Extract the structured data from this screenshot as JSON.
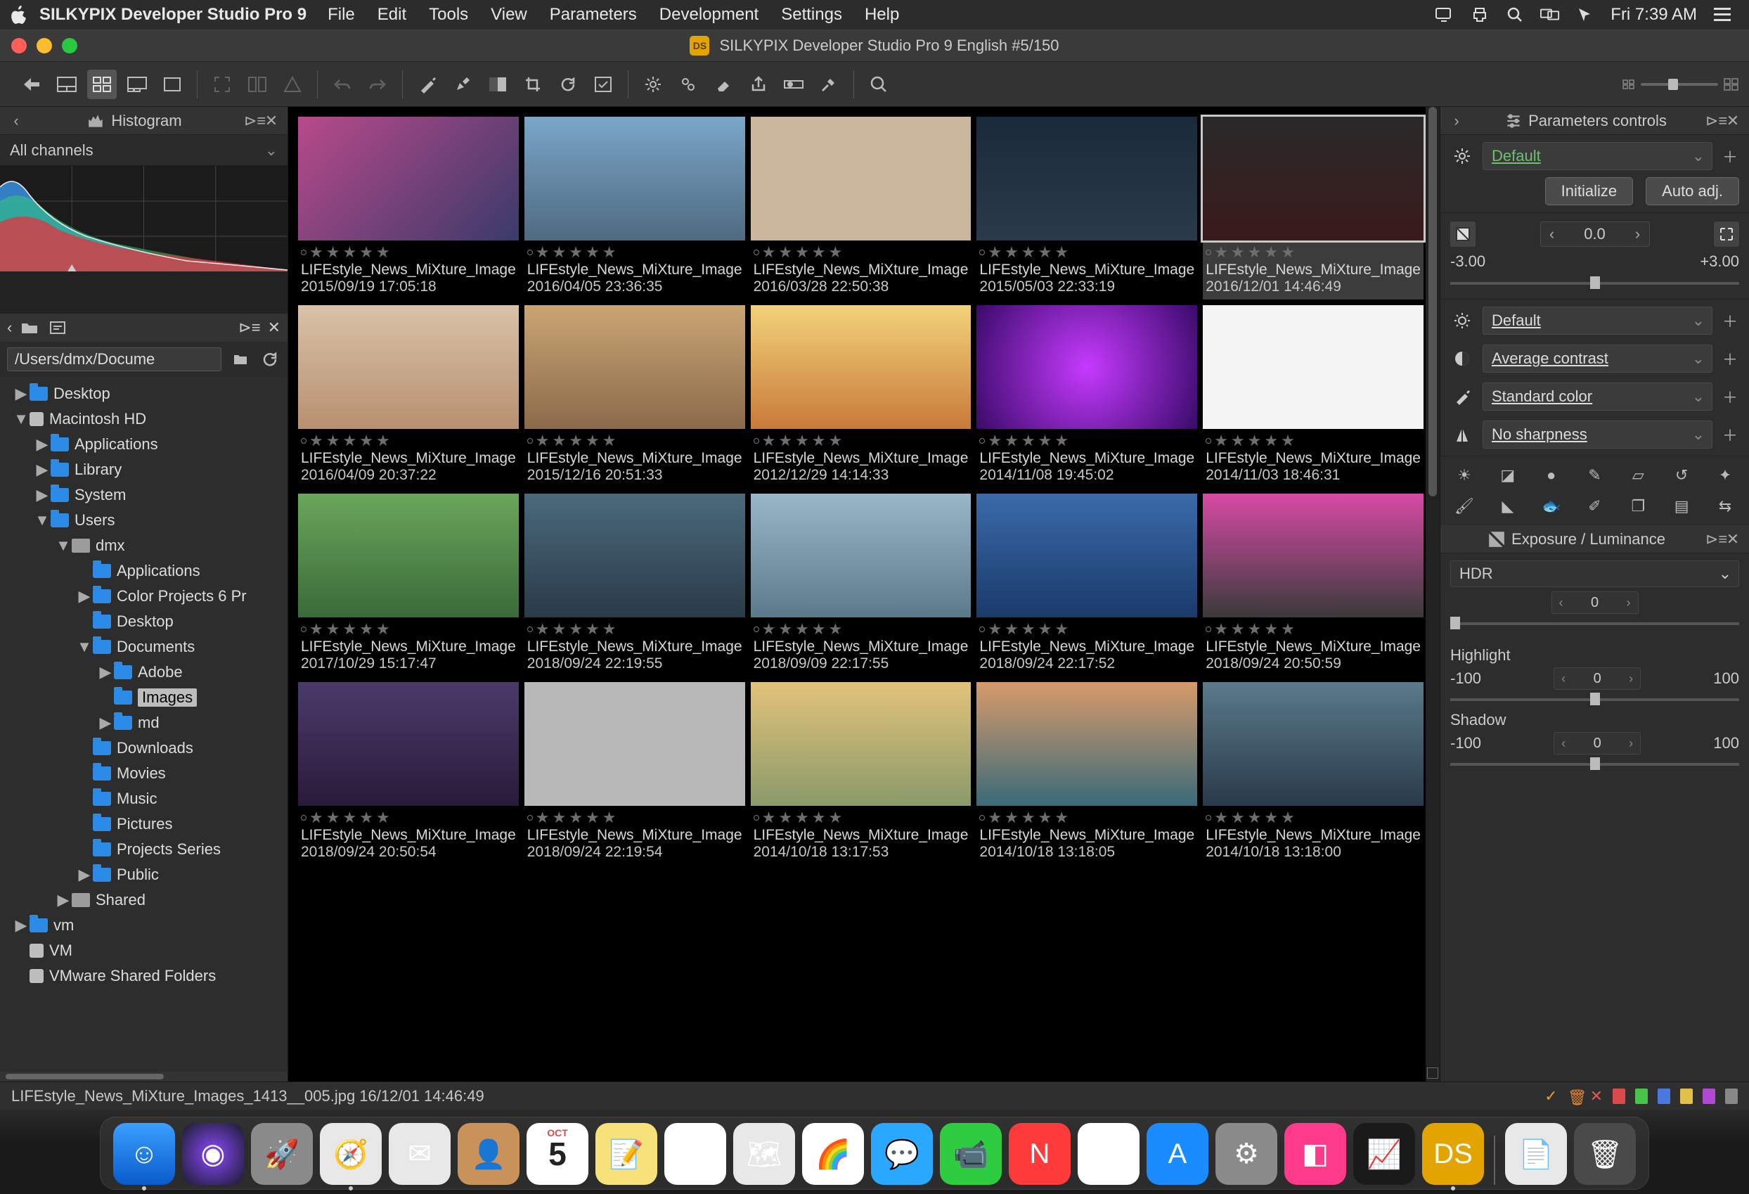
{
  "menubar": {
    "app": "SILKYPIX Developer Studio Pro 9",
    "menus": [
      "File",
      "Edit",
      "Tools",
      "View",
      "Parameters",
      "Development",
      "Settings",
      "Help"
    ],
    "clock": "Fri 7:39 AM"
  },
  "window": {
    "title": "SILKYPIX Developer Studio Pro 9 English   #5/150"
  },
  "histogram": {
    "title": "Histogram",
    "channel": "All channels"
  },
  "path_input": "/Users/dmx/Docume",
  "tree": [
    {
      "d": 0,
      "tw": "▶",
      "kind": "blue",
      "label": "Desktop"
    },
    {
      "d": 0,
      "tw": "▼",
      "kind": "disk",
      "label": "Macintosh HD"
    },
    {
      "d": 1,
      "tw": "▶",
      "kind": "blue",
      "label": "Applications"
    },
    {
      "d": 1,
      "tw": "▶",
      "kind": "blue",
      "label": "Library"
    },
    {
      "d": 1,
      "tw": "▶",
      "kind": "blue",
      "label": "System"
    },
    {
      "d": 1,
      "tw": "▼",
      "kind": "blue",
      "label": "Users"
    },
    {
      "d": 2,
      "tw": "▼",
      "kind": "grey",
      "label": "dmx"
    },
    {
      "d": 3,
      "tw": "",
      "kind": "blue",
      "label": "Applications"
    },
    {
      "d": 3,
      "tw": "▶",
      "kind": "blue",
      "label": "Color Projects 6 Pr"
    },
    {
      "d": 3,
      "tw": "",
      "kind": "blue",
      "label": "Desktop"
    },
    {
      "d": 3,
      "tw": "▼",
      "kind": "blue",
      "label": "Documents"
    },
    {
      "d": 4,
      "tw": "▶",
      "kind": "blue",
      "label": "Adobe"
    },
    {
      "d": 4,
      "tw": "",
      "kind": "blue",
      "label": "Images",
      "selected": true
    },
    {
      "d": 4,
      "tw": "▶",
      "kind": "blue",
      "label": "md"
    },
    {
      "d": 3,
      "tw": "",
      "kind": "blue",
      "label": "Downloads"
    },
    {
      "d": 3,
      "tw": "",
      "kind": "blue",
      "label": "Movies"
    },
    {
      "d": 3,
      "tw": "",
      "kind": "blue",
      "label": "Music"
    },
    {
      "d": 3,
      "tw": "",
      "kind": "blue",
      "label": "Pictures"
    },
    {
      "d": 3,
      "tw": "",
      "kind": "blue",
      "label": "Projects Series"
    },
    {
      "d": 3,
      "tw": "▶",
      "kind": "blue",
      "label": "Public"
    },
    {
      "d": 2,
      "tw": "▶",
      "kind": "grey",
      "label": "Shared"
    },
    {
      "d": 0,
      "tw": "▶",
      "kind": "blue",
      "label": "vm"
    },
    {
      "d": 0,
      "tw": "",
      "kind": "disk",
      "label": "VM"
    },
    {
      "d": 0,
      "tw": "",
      "kind": "disk",
      "label": "VMware Shared Folders"
    }
  ],
  "thumbs": [
    {
      "name_prefix": "LIFEstyle_News_MiXture_Image",
      "date": "2015/09/19 17:05:18",
      "bg": "linear-gradient(135deg,#b84a8a,#3a3a6a)"
    },
    {
      "name_prefix": "LIFEstyle_News_MiXture_Image",
      "date": "2016/04/05 23:36:35",
      "bg": "linear-gradient(#7aa6c9,#4f6a80)"
    },
    {
      "name_prefix": "LIFEstyle_News_MiXture_Image",
      "date": "2016/03/28 22:50:38",
      "bg": "#cbb79d"
    },
    {
      "name_prefix": "LIFEstyle_News_MiXture_Image",
      "date": "2015/05/03 22:33:19",
      "bg": "linear-gradient(#1a2a3a,#2a3a4a)"
    },
    {
      "name_prefix": "LIFEstyle_News_MiXture_Image",
      "date": "2016/12/01 14:46:49",
      "bg": "linear-gradient(#2a2a2a,#3a1a1a)",
      "selected": true
    },
    {
      "name_prefix": "LIFEstyle_News_MiXture_Image",
      "date": "2016/04/09 20:37:22",
      "bg": "linear-gradient(#d8c2a8,#b89070)"
    },
    {
      "name_prefix": "LIFEstyle_News_MiXture_Image",
      "date": "2015/12/16 20:51:33",
      "bg": "linear-gradient(#caa574,#8a6a4a)"
    },
    {
      "name_prefix": "LIFEstyle_News_MiXture_Image",
      "date": "2012/12/29 14:14:33",
      "bg": "linear-gradient(#f2d27a,#c97a3a)"
    },
    {
      "name_prefix": "LIFEstyle_News_MiXture_Image",
      "date": "2014/11/08 19:45:02",
      "bg": "radial-gradient(circle,#c63aff,#3a0a6a)"
    },
    {
      "name_prefix": "LIFEstyle_News_MiXture_Image",
      "date": "2014/11/03 18:46:31",
      "bg": "#f4f4f4"
    },
    {
      "name_prefix": "LIFEstyle_News_MiXture_Image",
      "date": "2017/10/29 15:17:47",
      "bg": "linear-gradient(#6aa65a,#3a6a3a)"
    },
    {
      "name_prefix": "LIFEstyle_News_MiXture_Image",
      "date": "2018/09/24 22:19:55",
      "bg": "linear-gradient(#4a6a7a,#2a3a4a)"
    },
    {
      "name_prefix": "LIFEstyle_News_MiXture_Image",
      "date": "2018/09/09 22:17:55",
      "bg": "linear-gradient(#9ab6c9,#5a7a8a)"
    },
    {
      "name_prefix": "LIFEstyle_News_MiXture_Image",
      "date": "2018/09/24 22:17:52",
      "bg": "linear-gradient(#3a6aaa,#1a3a6a)"
    },
    {
      "name_prefix": "LIFEstyle_News_MiXture_Image",
      "date": "2018/09/24 20:50:59",
      "bg": "linear-gradient(#d84aa6,#3a3a3a)"
    },
    {
      "name_prefix": "LIFEstyle_News_MiXture_Image",
      "date": "2018/09/24 20:50:54",
      "bg": "linear-gradient(#4a3a6a,#2a1a3a)"
    },
    {
      "name_prefix": "LIFEstyle_News_MiXture_Image",
      "date": "2018/09/24 22:19:54",
      "bg": "#b8b8b8"
    },
    {
      "name_prefix": "LIFEstyle_News_MiXture_Image",
      "date": "2014/10/18 13:17:53",
      "bg": "linear-gradient(#e2c37a,#8a9a6a)"
    },
    {
      "name_prefix": "LIFEstyle_News_MiXture_Image",
      "date": "2014/10/18 13:18:05",
      "bg": "linear-gradient(#d89a6a,#3a6a7a)"
    },
    {
      "name_prefix": "LIFEstyle_News_MiXture_Image",
      "date": "2014/10/18 13:18:00",
      "bg": "linear-gradient(#5a7a8a,#2a3a4a)"
    }
  ],
  "infobar": {
    "text": "LIFEstyle_News_MiXture_Images_1413__005.jpg 16/12/01 14:46:49"
  },
  "params": {
    "title": "Parameters controls",
    "preset": "Default",
    "init": "Initialize",
    "auto": "Auto adj.",
    "ev_value": "0.0",
    "ev_min": "-3.00",
    "ev_max": "+3.00",
    "wb": "Default",
    "contrast": "Average contrast",
    "color": "Standard color",
    "sharp": "No sharpness"
  },
  "exposure_panel": {
    "title": "Exposure / Luminance",
    "hdr_label": "HDR",
    "hdr_value": "0",
    "highlight_label": "Highlight",
    "hl_min": "-100",
    "hl_val": "0",
    "hl_max": "100",
    "shadow_label": "Shadow",
    "sh_min": "-100",
    "sh_val": "0",
    "sh_max": "100"
  },
  "dock": [
    {
      "name": "finder",
      "bg": "linear-gradient(#3aa0ff,#0a5acc)",
      "glyph": "☺"
    },
    {
      "name": "siri",
      "bg": "radial-gradient(circle,#8a4aff,#1a1a2a)",
      "glyph": "◉"
    },
    {
      "name": "launchpad",
      "bg": "#8a8a8a",
      "glyph": "🚀"
    },
    {
      "name": "safari",
      "bg": "#e8e8e8",
      "glyph": "🧭"
    },
    {
      "name": "mail",
      "bg": "#e8e8e8",
      "glyph": "✉"
    },
    {
      "name": "contacts",
      "bg": "#c8925a",
      "glyph": "👤"
    },
    {
      "name": "calendar",
      "bg": "#fff",
      "glyph": "5"
    },
    {
      "name": "notes",
      "bg": "#f7e27a",
      "glyph": "📝"
    },
    {
      "name": "reminders",
      "bg": "#fff",
      "glyph": "☑"
    },
    {
      "name": "maps",
      "bg": "#e8e8e8",
      "glyph": "🗺"
    },
    {
      "name": "photos",
      "bg": "#fff",
      "glyph": "🌈"
    },
    {
      "name": "messages",
      "bg": "#2aa8ff",
      "glyph": "💬"
    },
    {
      "name": "facetime",
      "bg": "#2ecc40",
      "glyph": "📹"
    },
    {
      "name": "news",
      "bg": "#ff3a3a",
      "glyph": "N"
    },
    {
      "name": "itunes",
      "bg": "#fff",
      "glyph": "♪"
    },
    {
      "name": "appstore",
      "bg": "#1a8cff",
      "glyph": "A"
    },
    {
      "name": "sysprefs",
      "bg": "#8a8a8a",
      "glyph": "⚙"
    },
    {
      "name": "cleanmymac",
      "bg": "#ff3a8a",
      "glyph": "◧"
    },
    {
      "name": "activity",
      "bg": "#1a1a1a",
      "glyph": "📈"
    },
    {
      "name": "silkypix",
      "bg": "#e4a400",
      "glyph": "DS"
    },
    {
      "name": "sep"
    },
    {
      "name": "docs",
      "bg": "#e8e8e8",
      "glyph": "📄"
    },
    {
      "name": "trash",
      "bg": "#4a4a4a",
      "glyph": "🗑"
    }
  ]
}
